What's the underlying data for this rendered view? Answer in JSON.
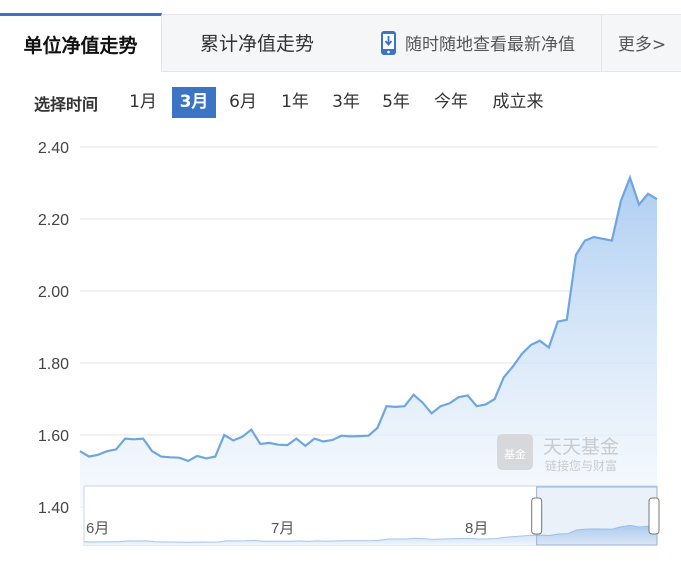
{
  "tabs": {
    "unit_nav": "单位净值走势",
    "cumulative_nav": "累计净值走势",
    "mobile_link": "随时随地查看最新净值",
    "more": "更多>"
  },
  "range": {
    "label": "选择时间",
    "options": [
      "1月",
      "3月",
      "6月",
      "1年",
      "3年",
      "5年",
      "今年",
      "成立来"
    ],
    "selected": "3月"
  },
  "watermark": {
    "title": "天天基金",
    "subtitle": "链接您与财富",
    "logo_text": "基金"
  },
  "colors": {
    "accent": "#3b74c4",
    "line": "#6ea6e0",
    "area_top": "#a9cbf1",
    "area_bottom": "#f2f7fd"
  },
  "chart_data": {
    "type": "area",
    "yticks": [
      "2.40",
      "2.20",
      "2.00",
      "1.80",
      "1.60",
      "1.40"
    ],
    "ylim": [
      1.4,
      2.4
    ],
    "grid": true,
    "xlabels": [
      "6月",
      "7月",
      "8月"
    ],
    "x": [
      0,
      1,
      2,
      3,
      4,
      5,
      6,
      7,
      8,
      9,
      10,
      11,
      12,
      13,
      14,
      15,
      16,
      17,
      18,
      19,
      20,
      21,
      22,
      23,
      24,
      25,
      26,
      27,
      28,
      29,
      30,
      31,
      32,
      33,
      34,
      35,
      36,
      37,
      38,
      39,
      40,
      41,
      42,
      43,
      44,
      45,
      46,
      47,
      48,
      49,
      50,
      51,
      52,
      53,
      54,
      55,
      56,
      57,
      58,
      59,
      60,
      61,
      62,
      63,
      64
    ],
    "values": [
      1.555,
      1.54,
      1.545,
      1.555,
      1.56,
      1.59,
      1.588,
      1.59,
      1.555,
      1.54,
      1.538,
      1.537,
      1.528,
      1.542,
      1.535,
      1.54,
      1.6,
      1.585,
      1.595,
      1.615,
      1.575,
      1.578,
      1.573,
      1.572,
      1.59,
      1.57,
      1.59,
      1.582,
      1.586,
      1.598,
      1.596,
      1.597,
      1.598,
      1.62,
      1.68,
      1.678,
      1.68,
      1.712,
      1.69,
      1.66,
      1.68,
      1.688,
      1.705,
      1.71,
      1.68,
      1.685,
      1.7,
      1.76,
      1.79,
      1.825,
      1.85,
      1.862,
      1.843,
      1.915,
      1.92,
      2.1,
      2.14,
      2.15,
      2.145,
      2.14,
      2.25,
      2.315,
      2.24,
      2.27,
      2.255
    ],
    "navigator": {
      "labels": [
        "6月",
        "7月",
        "8月"
      ],
      "selection": [
        0.79,
        1.0
      ]
    }
  }
}
